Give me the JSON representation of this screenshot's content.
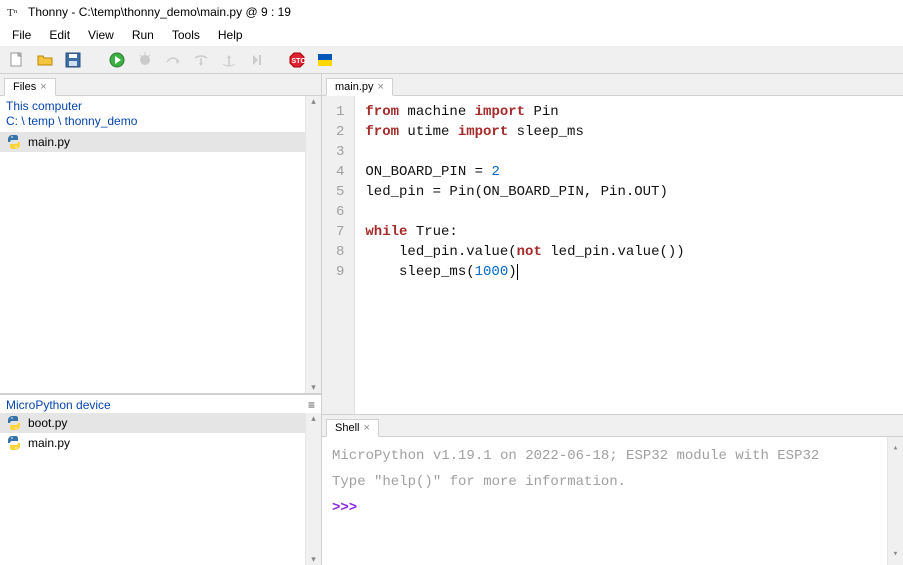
{
  "window": {
    "title": "Thonny  -  C:\\temp\\thonny_demo\\main.py  @  9 : 19"
  },
  "menu": [
    "File",
    "Edit",
    "View",
    "Run",
    "Tools",
    "Help"
  ],
  "left": {
    "files_tab": "Files",
    "this_computer_label": "This computer",
    "breadcrumb_parts": [
      "C:",
      "temp",
      "thonny_demo"
    ],
    "computer_files": [
      "main.py"
    ],
    "device_label": "MicroPython device",
    "device_files": [
      "boot.py",
      "main.py"
    ]
  },
  "editor": {
    "tab": "main.py",
    "lines": [
      {
        "n": 1,
        "tokens": [
          [
            "kw",
            "from"
          ],
          [
            "nm",
            " machine "
          ],
          [
            "kw",
            "import"
          ],
          [
            "nm",
            " Pin"
          ]
        ]
      },
      {
        "n": 2,
        "tokens": [
          [
            "kw",
            "from"
          ],
          [
            "nm",
            " utime "
          ],
          [
            "kw",
            "import"
          ],
          [
            "nm",
            " sleep_ms"
          ]
        ]
      },
      {
        "n": 3,
        "tokens": []
      },
      {
        "n": 4,
        "tokens": [
          [
            "nm",
            "ON_BOARD_PIN = "
          ],
          [
            "num",
            "2"
          ]
        ]
      },
      {
        "n": 5,
        "tokens": [
          [
            "nm",
            "led_pin = Pin(ON_BOARD_PIN, Pin.OUT)"
          ]
        ]
      },
      {
        "n": 6,
        "tokens": []
      },
      {
        "n": 7,
        "tokens": [
          [
            "kw",
            "while"
          ],
          [
            "nm",
            " True:"
          ]
        ]
      },
      {
        "n": 8,
        "tokens": [
          [
            "nm",
            "    led_pin.value("
          ],
          [
            "kw",
            "not"
          ],
          [
            "nm",
            " led_pin.value())"
          ]
        ]
      },
      {
        "n": 9,
        "tokens": [
          [
            "nm",
            "    sleep_ms("
          ],
          [
            "num",
            "1000"
          ],
          [
            "nm",
            ")"
          ],
          [
            "caret",
            ""
          ]
        ]
      }
    ]
  },
  "shell": {
    "tab": "Shell",
    "banner1": "MicroPython v1.19.1 on 2022-06-18; ESP32 module with ESP32",
    "banner2": "Type \"help()\" for more information.",
    "prompt": ">>>"
  }
}
